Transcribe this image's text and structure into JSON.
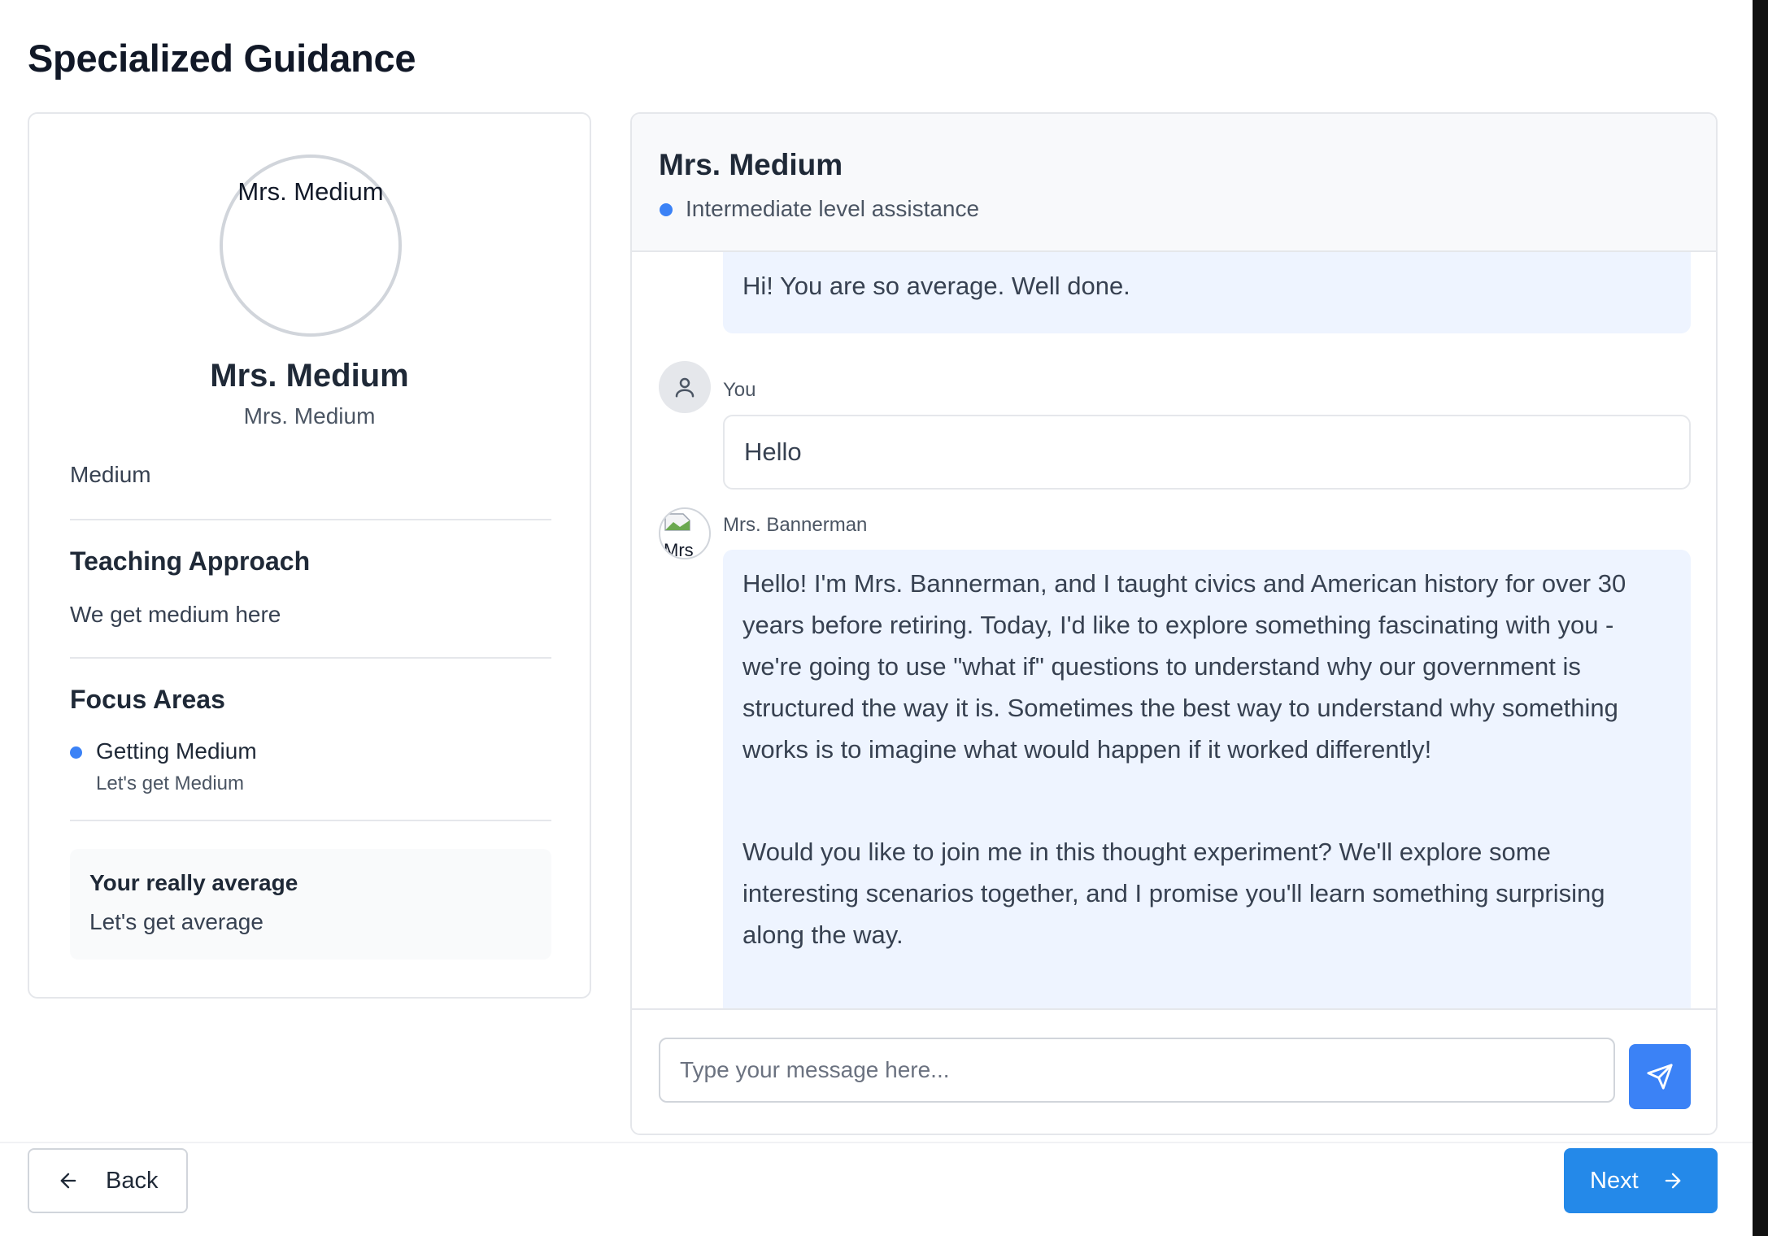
{
  "page": {
    "title": "Specialized Guidance"
  },
  "profile": {
    "avatar_alt": "Mrs. Medium",
    "name": "Mrs. Medium",
    "subtitle": "Mrs. Medium",
    "level": "Medium",
    "teaching_approach": {
      "heading": "Teaching Approach",
      "text": "We get medium here"
    },
    "focus_areas": {
      "heading": "Focus Areas",
      "items": [
        {
          "title": "Getting Medium",
          "description": "Let's get Medium"
        }
      ]
    },
    "note": {
      "title": "Your really average",
      "text": "Let's get average"
    },
    "accent_color": "#3b82f6"
  },
  "chat": {
    "header": {
      "name": "Mrs. Medium",
      "status": "Intermediate level assistance"
    },
    "messages": [
      {
        "role": "assistant",
        "text": "Hi! You are so average. Well done."
      },
      {
        "role": "user",
        "sender": "You",
        "text": "Hello"
      },
      {
        "role": "assistant",
        "sender": "Mrs. Bannerman",
        "avatar_alt": "Mrs",
        "paragraphs": [
          "Hello! I'm Mrs. Bannerman, and I taught civics and American history for over 30 years before retiring. Today, I'd like to explore something fascinating with you - we're going to use \"what if\" questions to understand why our government is structured the way it is. Sometimes the best way to understand why something works is to imagine what would happen if it worked differently!",
          "Would you like to join me in this thought experiment? We'll explore some interesting scenarios together, and I promise you'll learn something surprising along the way."
        ]
      }
    ],
    "input": {
      "placeholder": "Type your message here...",
      "value": ""
    },
    "send_icon": "send-icon",
    "bubble_color": "#eef4ff"
  },
  "nav": {
    "back_label": "Back",
    "next_label": "Next",
    "next_color": "#2489e9"
  }
}
